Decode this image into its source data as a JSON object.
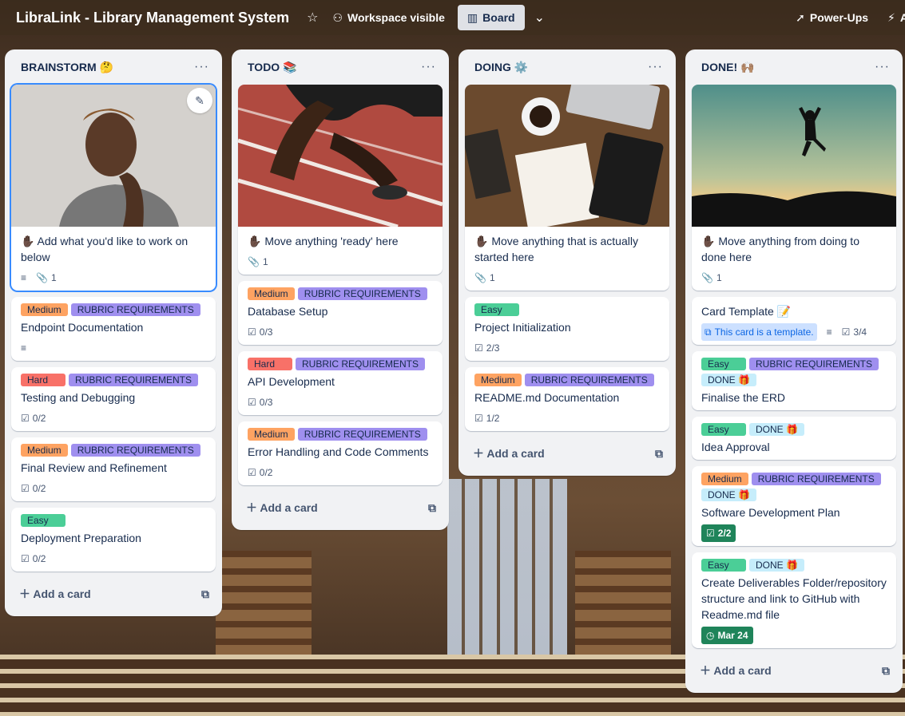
{
  "topbar": {
    "title": "LibraLink - Library Management System",
    "visibility": "Workspace visible",
    "view": "Board",
    "power_ups": "Power-Ups",
    "automation_initial": "A"
  },
  "lists": [
    {
      "title": "BRAINSTORM 🤔",
      "add_card": "Add a card",
      "cover_card": {
        "text": "✋🏿 Add what you'd like to work on below",
        "attachments": "1"
      },
      "cards": [
        {
          "labels": [
            "Medium",
            "RUBRIC REQUIREMENTS"
          ],
          "title": "Endpoint Documentation"
        },
        {
          "labels": [
            "Hard",
            "RUBRIC REQUIREMENTS"
          ],
          "title": "Testing and Debugging",
          "checklist": "0/2"
        },
        {
          "labels": [
            "Medium",
            "RUBRIC REQUIREMENTS"
          ],
          "title": "Final Review and Refinement",
          "checklist": "0/2"
        },
        {
          "labels": [
            "Easy"
          ],
          "title": "Deployment Preparation",
          "checklist": "0/2"
        }
      ]
    },
    {
      "title": "TODO 📚",
      "add_card": "Add a card",
      "cover_card": {
        "text": "✋🏿 Move anything 'ready' here",
        "attachments": "1"
      },
      "cards": [
        {
          "labels": [
            "Medium",
            "RUBRIC REQUIREMENTS"
          ],
          "title": "Database Setup",
          "checklist": "0/3"
        },
        {
          "labels": [
            "Hard",
            "RUBRIC REQUIREMENTS"
          ],
          "title": "API Development",
          "checklist": "0/3"
        },
        {
          "labels": [
            "Medium",
            "RUBRIC REQUIREMENTS"
          ],
          "title": "Error Handling and Code Comments",
          "checklist": "0/2"
        }
      ]
    },
    {
      "title": "DOING ⚙️",
      "add_card": "Add a card",
      "cover_card": {
        "text": "✋🏿 Move anything that is actually started here",
        "attachments": "1"
      },
      "cards": [
        {
          "labels": [
            "Easy"
          ],
          "title": "Project Initialization",
          "checklist": "2/3"
        },
        {
          "labels": [
            "Medium",
            "RUBRIC REQUIREMENTS"
          ],
          "title": "README.md Documentation",
          "checklist": "1/2"
        }
      ]
    },
    {
      "title": "DONE! 🙌🏽",
      "add_card": "Add a card",
      "cover_card": {
        "text": "✋🏿 Move anything from doing to done here",
        "attachments": "1"
      },
      "cards": [
        {
          "title": "Card Template 📝",
          "template_badge": "This card is a template.",
          "checklist": "3/4"
        },
        {
          "labels": [
            "Easy",
            "RUBRIC REQUIREMENTS",
            "DONE 🎁"
          ],
          "title": "Finalise the ERD"
        },
        {
          "labels": [
            "Easy",
            "DONE 🎁"
          ],
          "title": "Idea Approval"
        },
        {
          "labels": [
            "Medium",
            "RUBRIC REQUIREMENTS",
            "DONE 🎁"
          ],
          "title": "Software Development Plan",
          "checklist": "2/2"
        },
        {
          "labels": [
            "Easy",
            "DONE 🎁"
          ],
          "title": "Create Deliverables Folder/repository structure and link to GitHub with Readme.md file",
          "due": "Mar 24"
        }
      ]
    }
  ],
  "colors": {
    "medium": "#fea362",
    "rubric": "#9f8fef",
    "hard": "#f87168",
    "easy": "#4bce97",
    "done": "#c6edfb",
    "complete_badge": "#1f845a"
  }
}
